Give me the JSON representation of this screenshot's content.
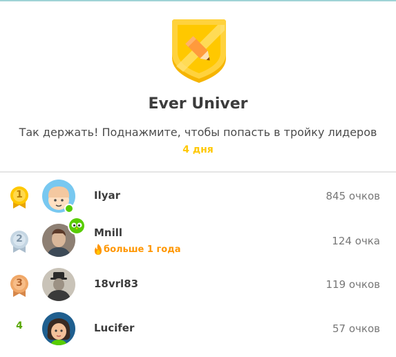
{
  "league": {
    "name": "Ever Univer",
    "message": "Так держать! Поднажмите, чтобы попасть в тройку лидеров",
    "days_left": "4 дня",
    "badge_color": "#ffc800"
  },
  "leaderboard": [
    {
      "rank": "1",
      "medal": "gold",
      "username": "Ilyar",
      "points": "845 очков",
      "online": true
    },
    {
      "rank": "2",
      "medal": "silver",
      "username": "Mnill",
      "streak": "больше 1 года",
      "points": "124 очка",
      "badge": "owl-icon"
    },
    {
      "rank": "3",
      "medal": "bronze",
      "username": "18vrl83",
      "points": "119 очков"
    },
    {
      "rank": "4",
      "username": "Lucifer",
      "points": "57 очков"
    }
  ]
}
